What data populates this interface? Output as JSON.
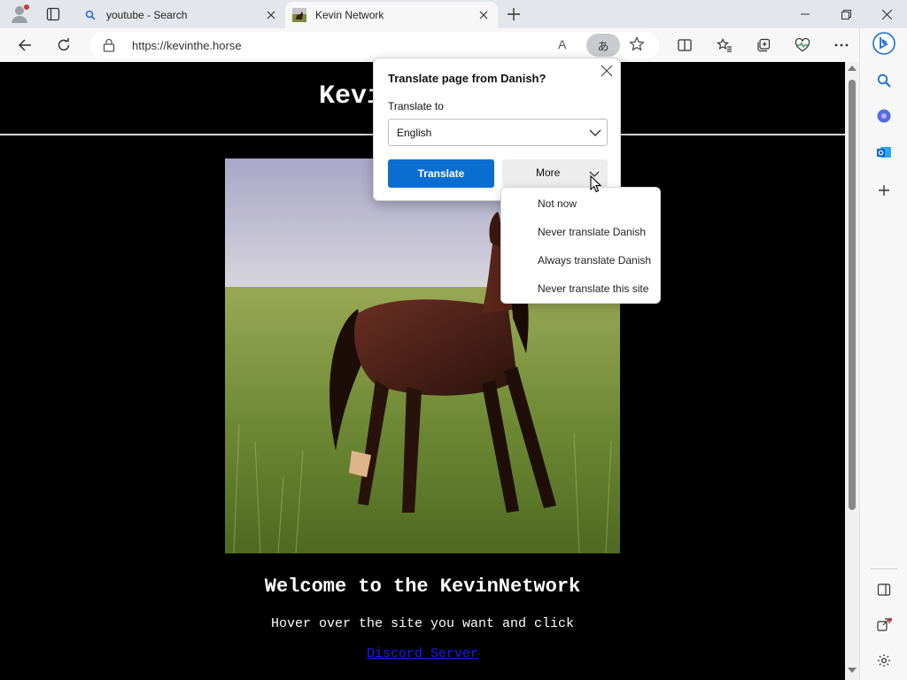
{
  "browser": {
    "tabs": [
      {
        "title": "youtube - Search",
        "icon": "search-icon",
        "active": false
      },
      {
        "title": "Kevin Network",
        "icon": "horse-favicon",
        "active": true
      }
    ],
    "address": {
      "url": "https://kevinthe.horse",
      "read_aloud_glyph": "A",
      "translate_glyph": "あ"
    }
  },
  "page": {
    "site_title": "Kevin Network",
    "hero_image": "horse-in-field",
    "welcome": "Welcome to the KevinNetwork",
    "hover_text": "Hover over the site you want and click",
    "discord_link": "Discord Server"
  },
  "translate_popup": {
    "title": "Translate page from Danish?",
    "translate_to_label": "Translate to",
    "selected_language": "English",
    "translate_button": "Translate",
    "more_button": "More",
    "menu_items": [
      "Not now",
      "Never translate Danish",
      "Always translate Danish",
      "Never translate this site"
    ]
  },
  "colors": {
    "accent": "#0a6ed1",
    "page_bg": "#000000",
    "link": "#1a1aff"
  }
}
